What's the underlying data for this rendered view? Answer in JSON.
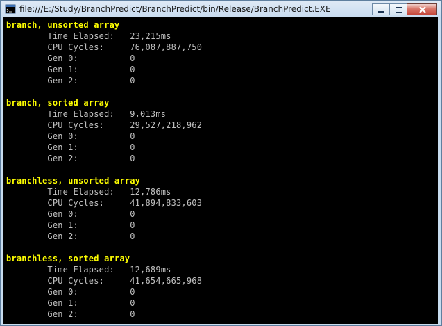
{
  "window": {
    "title": "file:///E:/Study/BranchPredict/BranchPredict/bin/Release/BranchPredict.EXE",
    "icon": "console-app-icon",
    "buttons": [
      "minimize-icon",
      "maximize-icon",
      "close-icon"
    ]
  },
  "colors": {
    "background": "#000000",
    "heading": "#ffff00",
    "text": "#c0c0c0"
  },
  "console": {
    "lines": [
      {
        "text": "branch, unsorted array",
        "style": "heading"
      },
      {
        "text": "        Time Elapsed:   23,215ms",
        "style": "normal"
      },
      {
        "text": "        CPU Cycles:     76,087,887,750",
        "style": "normal"
      },
      {
        "text": "        Gen 0:          0",
        "style": "normal"
      },
      {
        "text": "        Gen 1:          0",
        "style": "normal"
      },
      {
        "text": "        Gen 2:          0",
        "style": "normal"
      },
      {
        "text": "",
        "style": "normal"
      },
      {
        "text": "branch, sorted array",
        "style": "heading"
      },
      {
        "text": "        Time Elapsed:   9,013ms",
        "style": "normal"
      },
      {
        "text": "        CPU Cycles:     29,527,218,962",
        "style": "normal"
      },
      {
        "text": "        Gen 0:          0",
        "style": "normal"
      },
      {
        "text": "        Gen 1:          0",
        "style": "normal"
      },
      {
        "text": "        Gen 2:          0",
        "style": "normal"
      },
      {
        "text": "",
        "style": "normal"
      },
      {
        "text": "branchless, unsorted array",
        "style": "heading"
      },
      {
        "text": "        Time Elapsed:   12,786ms",
        "style": "normal"
      },
      {
        "text": "        CPU Cycles:     41,894,833,603",
        "style": "normal"
      },
      {
        "text": "        Gen 0:          0",
        "style": "normal"
      },
      {
        "text": "        Gen 1:          0",
        "style": "normal"
      },
      {
        "text": "        Gen 2:          0",
        "style": "normal"
      },
      {
        "text": "",
        "style": "normal"
      },
      {
        "text": "branchless, sorted array",
        "style": "heading"
      },
      {
        "text": "        Time Elapsed:   12,689ms",
        "style": "normal"
      },
      {
        "text": "        CPU Cycles:     41,654,665,968",
        "style": "normal"
      },
      {
        "text": "        Gen 0:          0",
        "style": "normal"
      },
      {
        "text": "        Gen 1:          0",
        "style": "normal"
      },
      {
        "text": "        Gen 2:          0",
        "style": "normal"
      }
    ]
  }
}
